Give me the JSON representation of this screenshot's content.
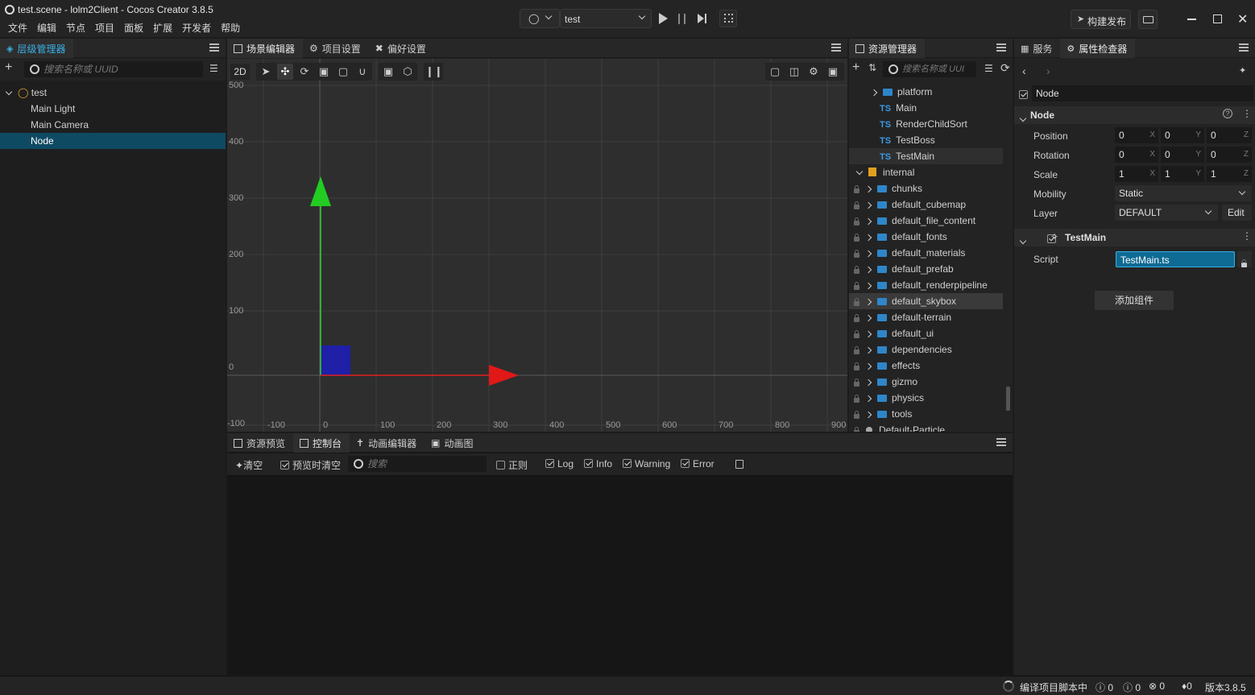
{
  "window": {
    "title": "test.scene - lolm2Client - Cocos Creator 3.8.5"
  },
  "menu": [
    "文件",
    "编辑",
    "节点",
    "项目",
    "面板",
    "扩展",
    "开发者",
    "帮助"
  ],
  "toolbar": {
    "scene_select": "test",
    "publish_label": "构建发布"
  },
  "hierarchy": {
    "tab_label": "层级管理器",
    "search_placeholder": "搜索名称或 UUID",
    "root": "test",
    "children": [
      "Main Light",
      "Main Camera",
      "Node"
    ],
    "selected": "Node"
  },
  "scene_editor": {
    "tabs": [
      "场景编辑器",
      "项目设置",
      "偏好设置"
    ],
    "mode_label": "2D",
    "y_ticks": [
      "500",
      "400",
      "300",
      "200",
      "100",
      "0"
    ],
    "x_ticks": [
      "-100",
      "0",
      "100",
      "200",
      "300",
      "400",
      "500",
      "600",
      "700",
      "800",
      "900"
    ],
    "corner_label": "-100"
  },
  "assets": {
    "tab_label": "资源管理器",
    "search_placeholder": "搜索名称或 UUI",
    "items": [
      {
        "label": "platform",
        "kind": "folder",
        "indent": 1,
        "expander": "right",
        "lock": false
      },
      {
        "label": "Main",
        "kind": "ts",
        "indent": 2,
        "expander": "",
        "lock": false
      },
      {
        "label": "RenderChildSort",
        "kind": "ts",
        "indent": 2,
        "expander": "",
        "lock": false
      },
      {
        "label": "TestBoss",
        "kind": "ts",
        "indent": 2,
        "expander": "",
        "lock": false
      },
      {
        "label": "TestMain",
        "kind": "ts",
        "indent": 2,
        "expander": "",
        "lock": false,
        "hl": "dim"
      },
      {
        "label": "internal",
        "kind": "db",
        "indent": 0,
        "expander": "down",
        "lock": false
      },
      {
        "label": "chunks",
        "kind": "folder",
        "indent": 1,
        "expander": "right",
        "lock": true
      },
      {
        "label": "default_cubemap",
        "kind": "folder",
        "indent": 1,
        "expander": "right",
        "lock": true
      },
      {
        "label": "default_file_content",
        "kind": "folder",
        "indent": 1,
        "expander": "right",
        "lock": true
      },
      {
        "label": "default_fonts",
        "kind": "folder",
        "indent": 1,
        "expander": "right",
        "lock": true
      },
      {
        "label": "default_materials",
        "kind": "folder",
        "indent": 1,
        "expander": "right",
        "lock": true
      },
      {
        "label": "default_prefab",
        "kind": "folder",
        "indent": 1,
        "expander": "right",
        "lock": true
      },
      {
        "label": "default_renderpipeline",
        "kind": "folder",
        "indent": 1,
        "expander": "right",
        "lock": true
      },
      {
        "label": "default_skybox",
        "kind": "folder",
        "indent": 1,
        "expander": "right",
        "lock": true,
        "hl": "hover"
      },
      {
        "label": "default-terrain",
        "kind": "folder",
        "indent": 1,
        "expander": "right",
        "lock": true
      },
      {
        "label": "default_ui",
        "kind": "folder",
        "indent": 1,
        "expander": "right",
        "lock": true
      },
      {
        "label": "dependencies",
        "kind": "folder",
        "indent": 1,
        "expander": "right",
        "lock": true
      },
      {
        "label": "effects",
        "kind": "folder",
        "indent": 1,
        "expander": "right",
        "lock": true
      },
      {
        "label": "gizmo",
        "kind": "folder",
        "indent": 1,
        "expander": "right",
        "lock": true
      },
      {
        "label": "physics",
        "kind": "folder",
        "indent": 1,
        "expander": "right",
        "lock": true
      },
      {
        "label": "tools",
        "kind": "folder",
        "indent": 1,
        "expander": "right",
        "lock": true
      },
      {
        "label": "Default-Particle",
        "kind": "dot",
        "indent": 1,
        "expander": "",
        "lock": true
      }
    ]
  },
  "inspector": {
    "tabs": [
      "服务",
      "属性检查器"
    ],
    "node_name": "Node",
    "section_node": "Node",
    "position": {
      "label": "Position",
      "x": "0",
      "y": "0",
      "z": "0"
    },
    "rotation": {
      "label": "Rotation",
      "x": "0",
      "y": "0",
      "z": "0"
    },
    "scale": {
      "label": "Scale",
      "x": "1",
      "y": "1",
      "z": "1"
    },
    "mobility": {
      "label": "Mobility",
      "value": "Static"
    },
    "layer": {
      "label": "Layer",
      "value": "DEFAULT",
      "edit": "Edit"
    },
    "component": {
      "name": "TestMain",
      "script_label": "Script",
      "script_value": "TestMain.ts"
    },
    "add_component": "添加组件",
    "axis_x": "X",
    "axis_y": "Y",
    "axis_z": "Z"
  },
  "console": {
    "tabs": [
      "资源预览",
      "控制台",
      "动画编辑器",
      "动画图"
    ],
    "clear_label": "清空",
    "preview_clear_label": "预览时清空",
    "search_placeholder": "搜索",
    "regex_label": "正则",
    "log_label": "Log",
    "info_label": "Info",
    "warning_label": "Warning",
    "error_label": "Error"
  },
  "status": {
    "compiling": "编译项目脚本中",
    "info_count": "0",
    "warn_count": "0",
    "error_count": "0",
    "notif_count": "0",
    "version": "版本3.8.5"
  }
}
